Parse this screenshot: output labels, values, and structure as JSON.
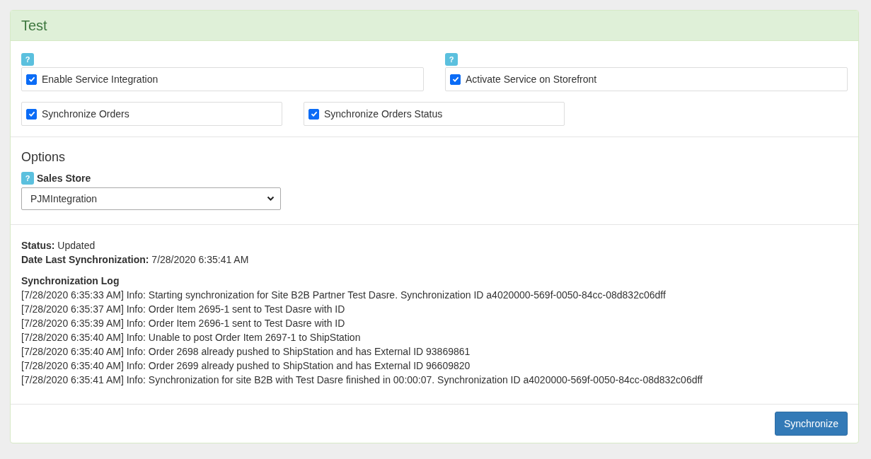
{
  "panel": {
    "title": "Test"
  },
  "settings": [
    {
      "label": "Enable Service Integration",
      "checked": true,
      "help": "?",
      "kind": "wide"
    },
    {
      "label": "Activate Service on Storefront",
      "checked": true,
      "help": "?",
      "kind": "wide"
    },
    {
      "label": "Synchronize Orders",
      "checked": true,
      "kind": "narrow"
    },
    {
      "label": "Synchronize Orders Status",
      "checked": true,
      "kind": "narrow"
    }
  ],
  "options": {
    "title": "Options",
    "help": "?",
    "label": "Sales Store",
    "value": "PJMIntegration"
  },
  "status": [
    {
      "label": "Status:",
      "value": "Updated"
    },
    {
      "label": "Date Last Synchronization:",
      "value": "7/28/2020 6:35:41 AM"
    }
  ],
  "log": {
    "title": "Synchronization Log",
    "lines": [
      "[7/28/2020 6:35:33 AM] Info: Starting synchronization for Site B2B Partner Test Dasre. Synchronization ID a4020000-569f-0050-84cc-08d832c06dff",
      "[7/28/2020 6:35:37 AM] Info: Order Item 2695-1 sent to Test Dasre with ID",
      "[7/28/2020 6:35:39 AM] Info: Order Item 2696-1 sent to Test Dasre with ID",
      "[7/28/2020 6:35:40 AM] Info: Unable to post Order Item 2697-1 to ShipStation",
      "[7/28/2020 6:35:40 AM] Info: Order 2698 already pushed to ShipStation and has External ID 93869861",
      "[7/28/2020 6:35:40 AM] Info: Order 2699 already pushed to ShipStation and has External ID 96609820",
      "[7/28/2020 6:35:41 AM] Info: Synchronization for site B2B with Test Dasre finished in 00:00:07. Synchronization ID a4020000-569f-0050-84cc-08d832c06dff"
    ]
  },
  "footer": {
    "button": "Synchronize"
  }
}
